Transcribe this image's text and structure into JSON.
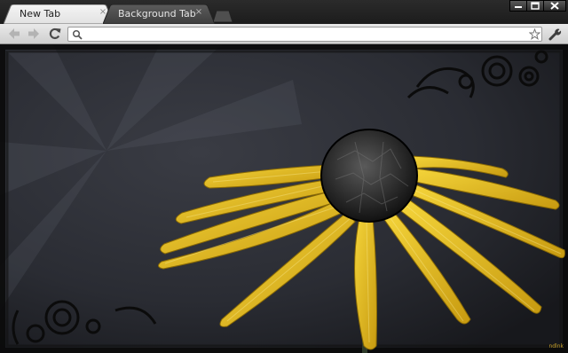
{
  "tabs": [
    {
      "title": "New Tab",
      "close_glyph": "×",
      "active": true
    },
    {
      "title": "Background Tab",
      "close_glyph": "×",
      "active": false
    }
  ],
  "window_controls": {
    "minimize_icon": "minimize-icon",
    "maximize_icon": "maximize-icon",
    "close_icon": "close-icon"
  },
  "toolbar": {
    "back_icon": "back-arrow-icon",
    "forward_icon": "forward-arrow-icon",
    "reload_icon": "reload-icon",
    "omnibox_value": "",
    "omnibox_icon": "search-icon",
    "star_icon": "star-icon",
    "menu_icon": "wrench-icon"
  },
  "content": {
    "theme_image": "yellow flower",
    "watermark": "ndlnk"
  },
  "colors": {
    "frame": "#1c1c1c",
    "active_tab": "#e6e6e6",
    "inactive_tab": "#4a4a4a",
    "toolbar": "#dcdcdc",
    "petal": "#e8c21c",
    "background": "#2a2c33"
  }
}
